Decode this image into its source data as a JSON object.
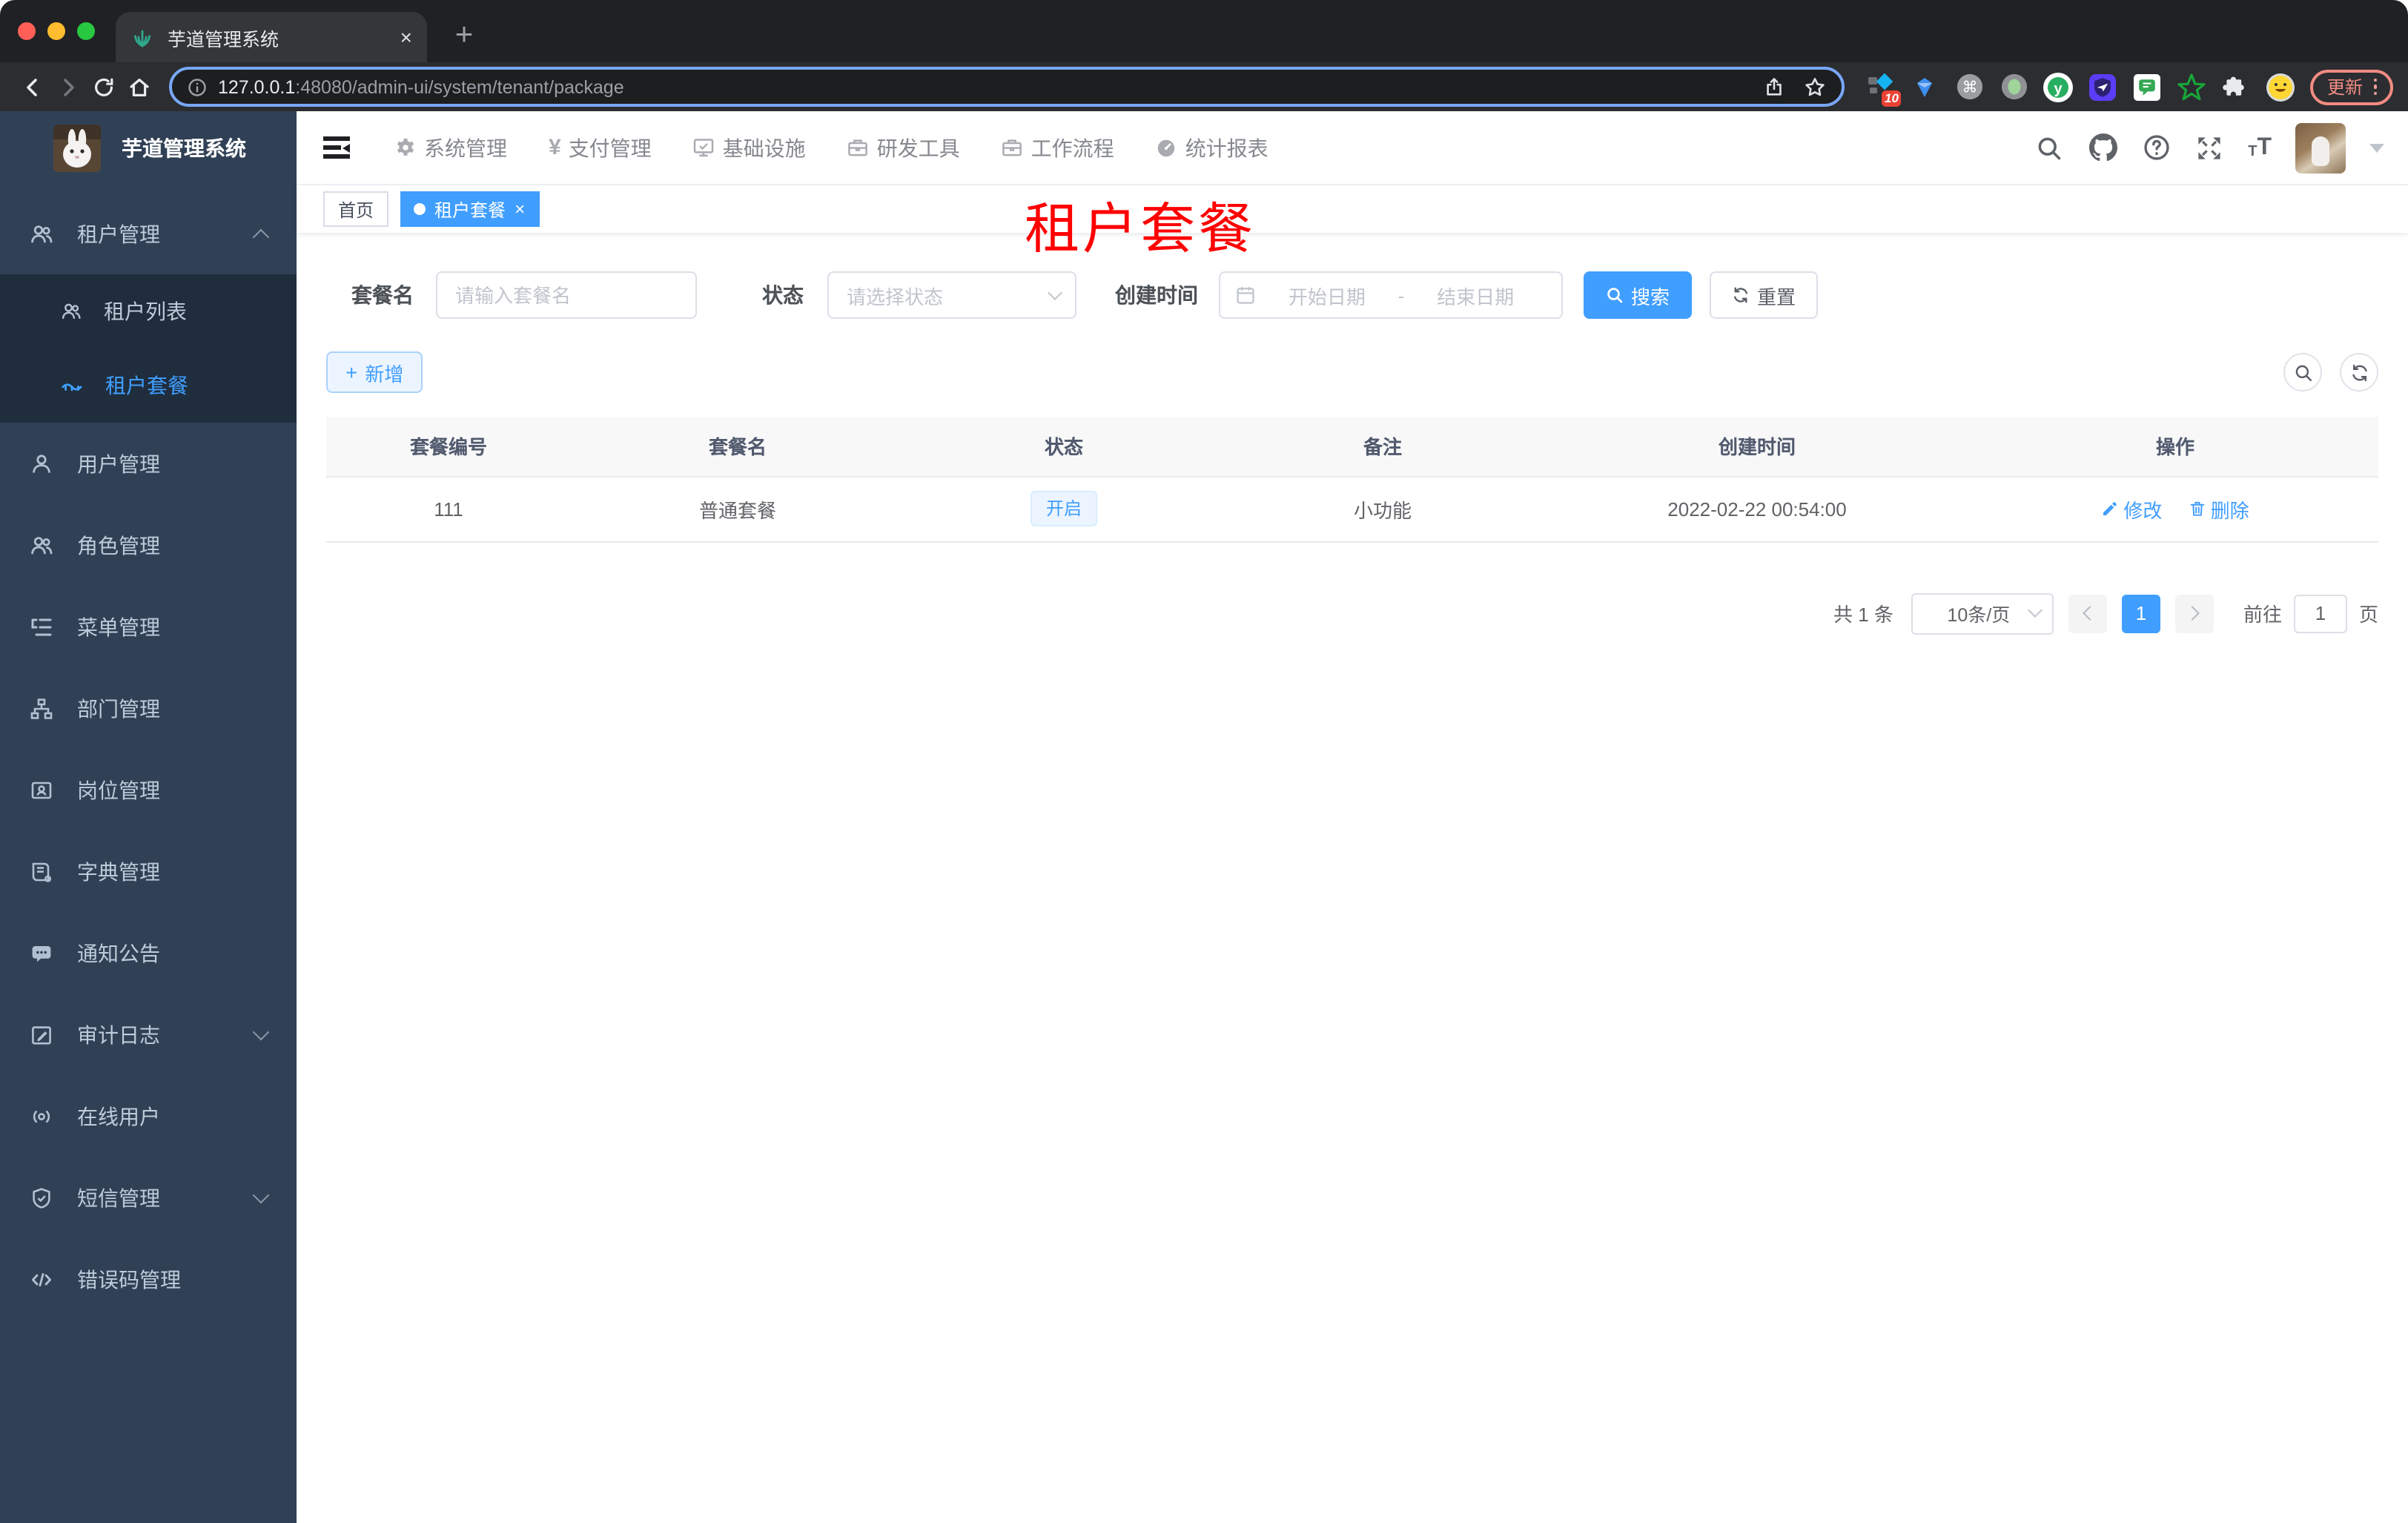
{
  "browser": {
    "tab": {
      "title": "芋道管理系统"
    },
    "url": {
      "host": "127.0.0.1",
      "rest": ":48080/admin-ui/system/tenant/package"
    },
    "extensions_badge": "10",
    "update_label": "更新"
  },
  "icons": {
    "close": "×",
    "plus": "+",
    "yen": "¥",
    "question": "?",
    "t_small": "T",
    "t_big": "T"
  },
  "header": {
    "logo_title": "芋道管理系统",
    "nav": [
      {
        "label": "系统管理"
      },
      {
        "label": "支付管理"
      },
      {
        "label": "基础设施"
      },
      {
        "label": "研发工具"
      },
      {
        "label": "工作流程"
      },
      {
        "label": "统计报表"
      }
    ]
  },
  "sidebar": {
    "groups": [
      {
        "label": "租户管理",
        "children": [
          {
            "label": "租户列表"
          },
          {
            "label": "租户套餐"
          }
        ]
      },
      {
        "label": "用户管理"
      },
      {
        "label": "角色管理"
      },
      {
        "label": "菜单管理"
      },
      {
        "label": "部门管理"
      },
      {
        "label": "岗位管理"
      },
      {
        "label": "字典管理"
      },
      {
        "label": "通知公告"
      },
      {
        "label": "审计日志"
      },
      {
        "label": "在线用户"
      },
      {
        "label": "短信管理"
      },
      {
        "label": "错误码管理"
      }
    ]
  },
  "tags": {
    "home": "首页",
    "active": "租户套餐"
  },
  "overlay_title": "租户套餐",
  "filters": {
    "name_label": "套餐名",
    "name_placeholder": "请输入套餐名",
    "status_label": "状态",
    "status_placeholder": "请选择状态",
    "date_label": "创建时间",
    "date_start": "开始日期",
    "date_sep": "-",
    "date_end": "结束日期",
    "search": "搜索",
    "reset": "重置"
  },
  "toolbar": {
    "add": "新增"
  },
  "table": {
    "columns": [
      "套餐编号",
      "套餐名",
      "状态",
      "备注",
      "创建时间",
      "操作"
    ],
    "rows": [
      {
        "id": "111",
        "name": "普通套餐",
        "status": "开启",
        "remark": "小功能",
        "created": "2022-02-22 00:54:00",
        "edit": "修改",
        "delete": "删除"
      }
    ]
  },
  "pagination": {
    "total": "共 1 条",
    "page_size": "10条/页",
    "page": "1",
    "goto": "前往",
    "goto_value": "1",
    "unit": "页"
  },
  "colors": {
    "accent": "#409eff",
    "sidebar_bg": "#304156",
    "submenu_bg": "#1f2d3d",
    "overlay_red": "#fe0000",
    "status_tag_bg": "#ecf5ff"
  }
}
